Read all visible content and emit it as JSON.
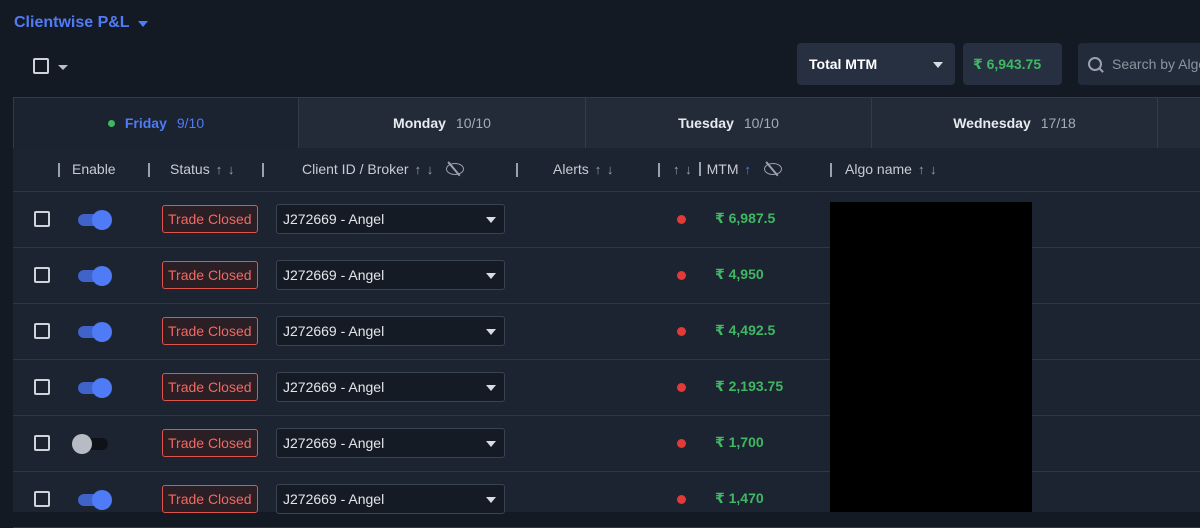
{
  "header": {
    "title": "Clientwise P&L",
    "mtm_select": "Total MTM",
    "total_mtm": "₹ 6,943.75",
    "search_placeholder": "Search by Algo"
  },
  "tabs": [
    {
      "day": "Friday",
      "count": "9/10",
      "active": true
    },
    {
      "day": "Monday",
      "count": "10/10",
      "active": false
    },
    {
      "day": "Tuesday",
      "count": "10/10",
      "active": false
    },
    {
      "day": "Wednesday",
      "count": "17/18",
      "active": false
    }
  ],
  "columns": {
    "enable": "Enable",
    "status": "Status",
    "client": "Client ID / Broker",
    "alerts": "Alerts",
    "mtm": "MTM",
    "algo": "Algo name"
  },
  "rows": [
    {
      "enabled": true,
      "status": "Trade Closed",
      "client": "J272669 - Angel",
      "mtm": "₹ 6,987.5"
    },
    {
      "enabled": true,
      "status": "Trade Closed",
      "client": "J272669 - Angel",
      "mtm": "₹ 4,950"
    },
    {
      "enabled": true,
      "status": "Trade Closed",
      "client": "J272669 - Angel",
      "mtm": "₹ 4,492.5"
    },
    {
      "enabled": true,
      "status": "Trade Closed",
      "client": "J272669 - Angel",
      "mtm": "₹ 2,193.75"
    },
    {
      "enabled": false,
      "status": "Trade Closed",
      "client": "J272669 - Angel",
      "mtm": "₹ 1,700"
    },
    {
      "enabled": true,
      "status": "Trade Closed",
      "client": "J272669 - Angel",
      "mtm": "₹ 1,470"
    }
  ],
  "colors": {
    "accent": "#4f7cf6",
    "profit": "#3fb863",
    "alert": "#e23b36",
    "status_closed": "#f06a63"
  }
}
